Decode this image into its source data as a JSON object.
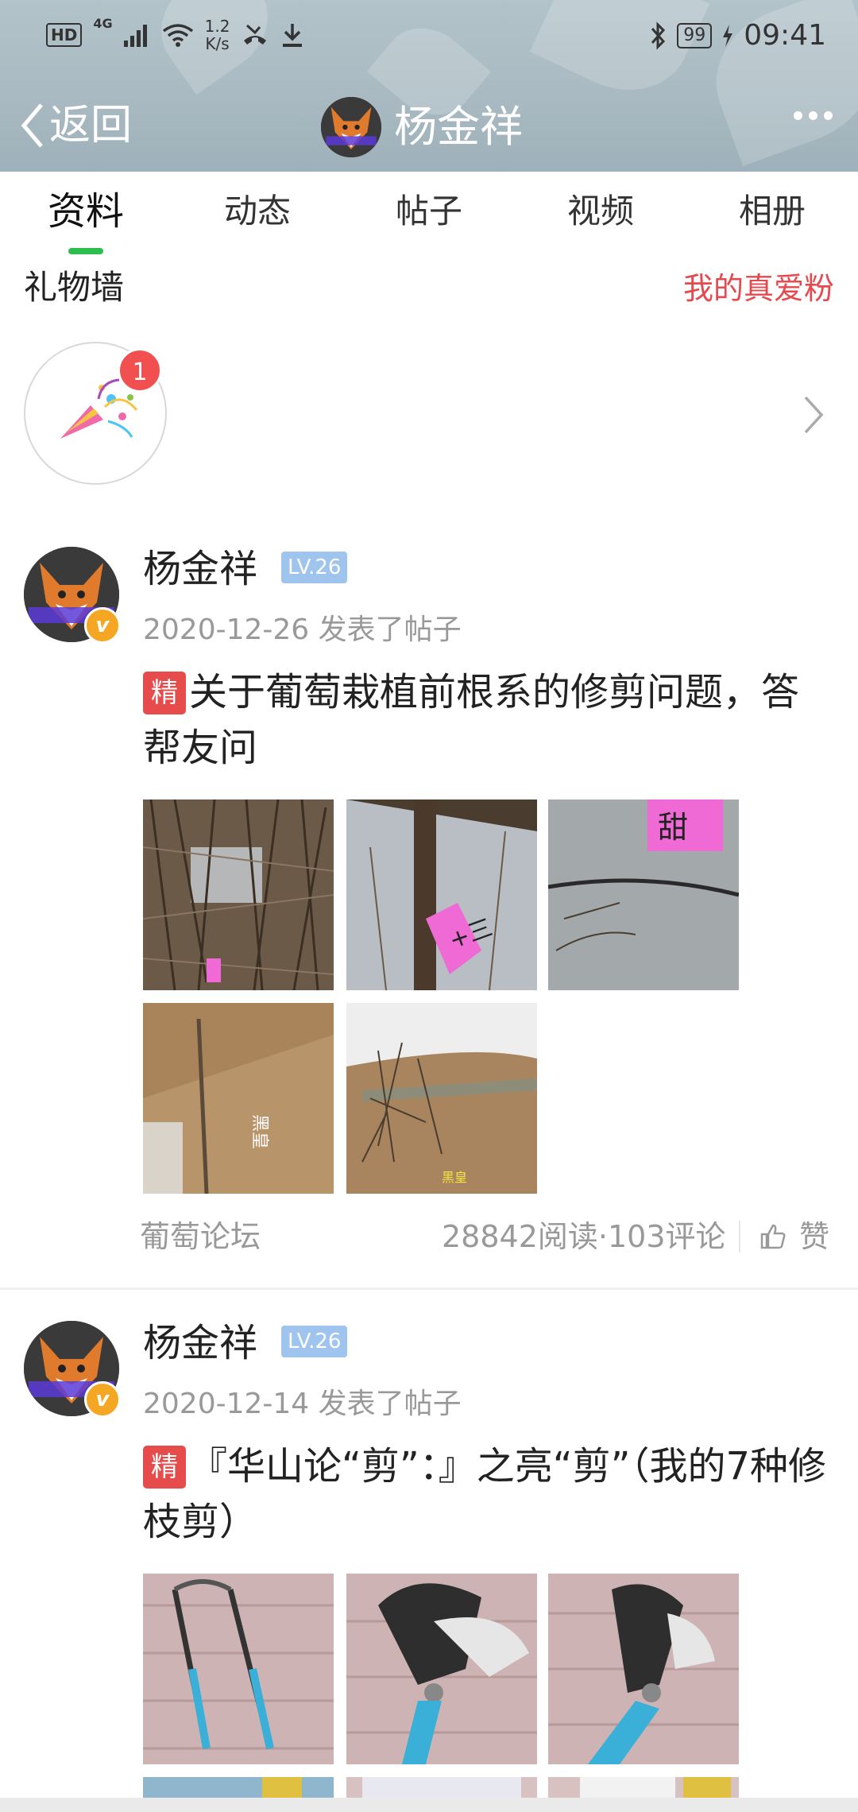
{
  "status_bar": {
    "hd": "HD",
    "network_type": "4G",
    "net_speed_value": "1.2",
    "net_speed_unit": "K/s",
    "battery": "99",
    "time": "09:41"
  },
  "nav": {
    "back_label": "返回",
    "title": "杨金祥"
  },
  "tabs": [
    {
      "label": "资料",
      "active": true
    },
    {
      "label": "动态",
      "active": false
    },
    {
      "label": "帖子",
      "active": false
    },
    {
      "label": "视频",
      "active": false
    },
    {
      "label": "相册",
      "active": false
    }
  ],
  "gift_wall": {
    "title": "礼物墙",
    "fans_link": "我的真爱粉",
    "badge_count": "1"
  },
  "posts": [
    {
      "author": "杨金祥",
      "level": "LV.26",
      "date": "2020-12-26",
      "action": "发表了帖子",
      "tag": "精",
      "title": "关于葡萄栽植前根系的修剪问题，答帮友问",
      "thumb_labels": [
        "黑皇",
        "黑皇"
      ],
      "forum": "葡萄论坛",
      "stats": "28842阅读·103评论",
      "like_label": "赞"
    },
    {
      "author": "杨金祥",
      "level": "LV.26",
      "date": "2020-12-14",
      "action": "发表了帖子",
      "tag": "精",
      "title": "『华山论“剪”：』之亮“剪”（我的7种修枝剪）"
    }
  ],
  "colors": {
    "accent_green": "#2ebd4f",
    "link_red": "#e5484d",
    "badge_red": "#f25050",
    "level_blue": "#9fc4ee",
    "vip_orange": "#f5a623"
  }
}
